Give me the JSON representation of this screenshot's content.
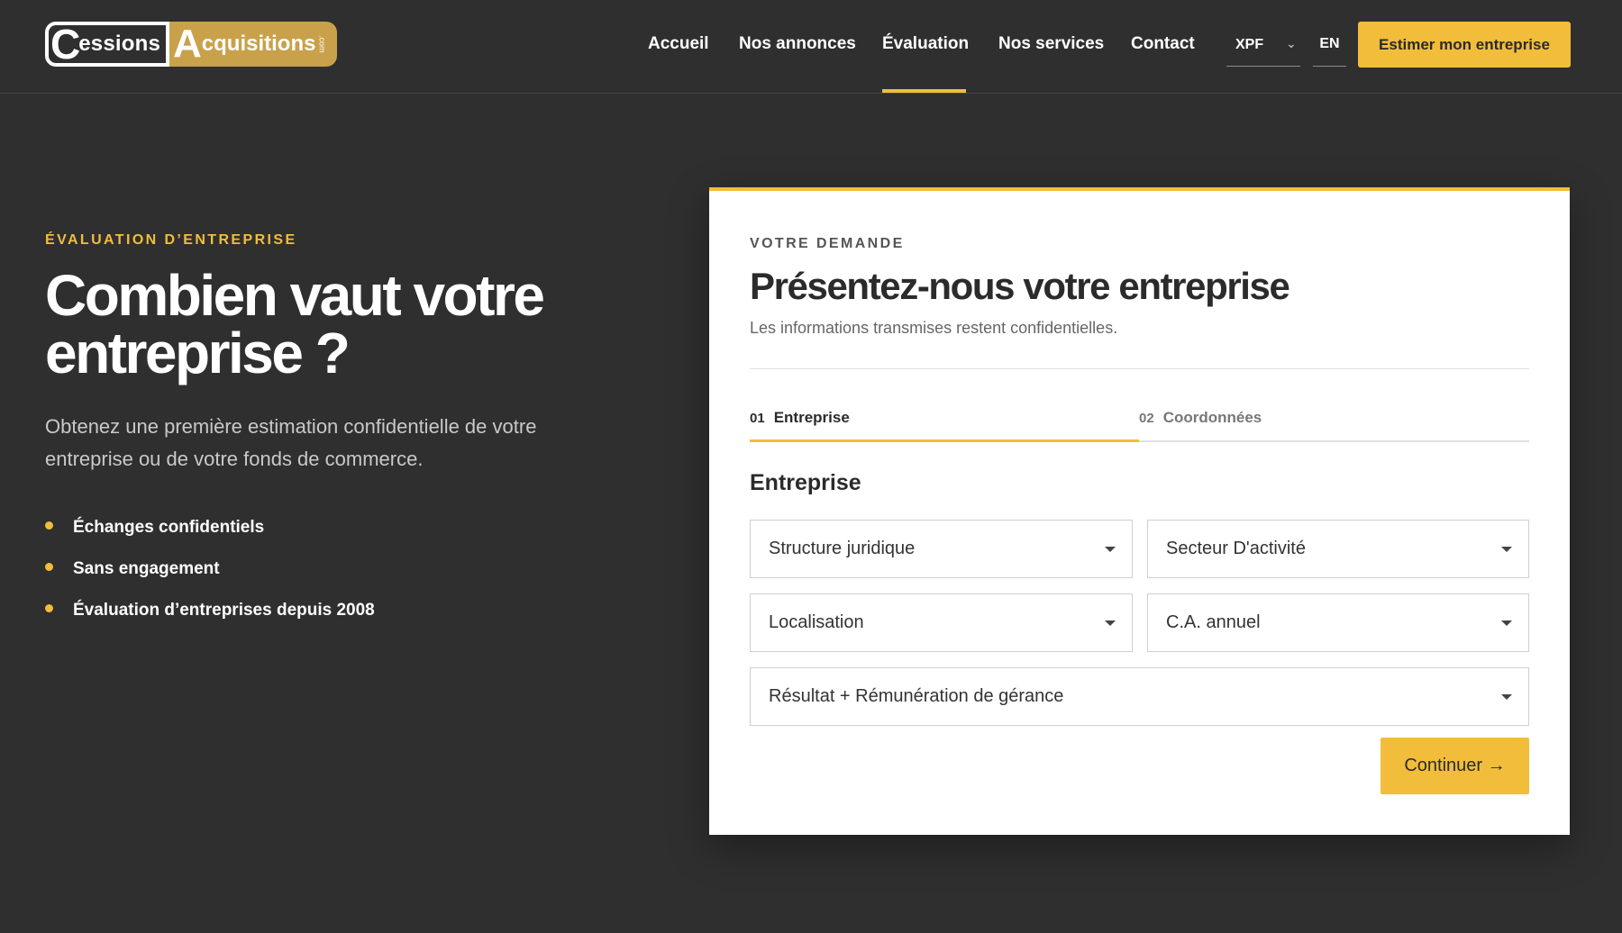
{
  "header": {
    "logo": {
      "word1": "essions",
      "word2": "cquisitions",
      "suffix": ".com"
    },
    "nav": [
      {
        "label": "Accueil"
      },
      {
        "label": "Nos annonces"
      },
      {
        "label": "Évaluation",
        "active": true
      },
      {
        "label": "Nos services"
      },
      {
        "label": "Contact"
      }
    ],
    "currency": "XPF",
    "language": "EN",
    "cta_label": "Estimer mon entreprise"
  },
  "hero": {
    "eyebrow": "ÉVALUATION D’ENTREPRISE",
    "title_line1": "Combien vaut votre",
    "title_line2": "entreprise ?",
    "subtitle": "Obtenez une première estimation confidentielle de votre entreprise ou de votre fonds de commerce.",
    "bullets": [
      "Échanges confidentiels",
      "Sans engagement",
      "Évaluation d’entreprises depuis 2008"
    ]
  },
  "form": {
    "eyebrow": "VOTRE DEMANDE",
    "title": "Présentez-nous votre entreprise",
    "subtitle": "Les informations transmises restent confidentielles.",
    "steps": [
      {
        "number": "01",
        "label": "Entreprise",
        "active": true
      },
      {
        "number": "02",
        "label": "Coordonnées",
        "active": false
      }
    ],
    "section_title": "Entreprise",
    "fields": [
      {
        "label": "Structure juridique"
      },
      {
        "label": "Secteur D'activité"
      },
      {
        "label": "Localisation"
      },
      {
        "label": "C.A. annuel"
      },
      {
        "label": "Résultat + Rémunération de gérance"
      }
    ],
    "continue_label": "Continuer →"
  },
  "colors": {
    "background": "#2f2f30",
    "accent": "#f2bd3a",
    "logo_gold": "#c9a14a",
    "card": "#ffffff"
  }
}
